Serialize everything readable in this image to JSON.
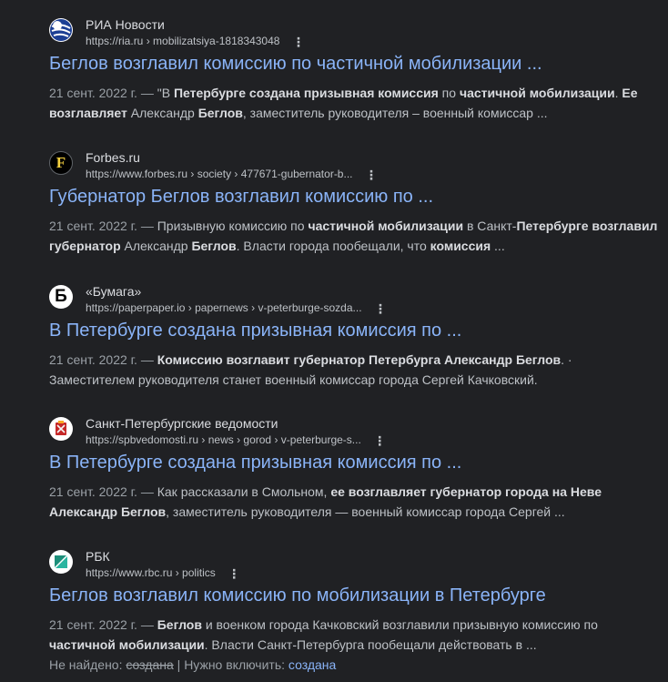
{
  "results": [
    {
      "site_name": "РИА Новости",
      "url_domain": "https://ria.ru",
      "url_path": "› mobilizatsiya-1818343048",
      "title": "Беглов возглавил комиссию по частичной мобилизации ...",
      "date": "21 сент. 2022 г. —",
      "snippet": [
        {
          "t": " \"В ",
          "b": false
        },
        {
          "t": "Петербурге создана призывная комиссия",
          "b": true
        },
        {
          "t": " по ",
          "b": false
        },
        {
          "t": "частичной мобилизации",
          "b": true
        },
        {
          "t": ". ",
          "b": false
        },
        {
          "t": "Ее возглавляет",
          "b": true
        },
        {
          "t": " Александр ",
          "b": false
        },
        {
          "t": "Беглов",
          "b": true
        },
        {
          "t": ", заместитель руководителя – военный комиссар ...",
          "b": false
        }
      ],
      "icon": "ria-globe-icon"
    },
    {
      "site_name": "Forbes.ru",
      "url_domain": "https://www.forbes.ru",
      "url_path": "› society › 477671-gubernator-b...",
      "title": "Губернатор Беглов возглавил комиссию по ...",
      "date": "21 сент. 2022 г. —",
      "snippet": [
        {
          "t": " Призывную комиссию по ",
          "b": false
        },
        {
          "t": "частичной мобилизации",
          "b": true
        },
        {
          "t": " в Санкт-",
          "b": false
        },
        {
          "t": "Петербурге возглавил губернатор",
          "b": true
        },
        {
          "t": " Александр ",
          "b": false
        },
        {
          "t": "Беглов",
          "b": true
        },
        {
          "t": ". Власти города пообещали, что ",
          "b": false
        },
        {
          "t": "комиссия",
          "b": true
        },
        {
          "t": " ...",
          "b": false
        }
      ],
      "icon": "forbes-f-icon",
      "icon_letter": "F"
    },
    {
      "site_name": "«Бумага»",
      "url_domain": "https://paperpaper.io",
      "url_path": "› papernews › v-peterburge-sozda...",
      "title": "В Петербурге создана призывная комиссия по ...",
      "date": "21 сент. 2022 г. —",
      "snippet": [
        {
          "t": " ",
          "b": false
        },
        {
          "t": "Комиссию возглавит губернатор Петербурга Александр Беглов",
          "b": true
        },
        {
          "t": ". · Заместителем руководителя станет военный комиссар города Сергей Качковский.",
          "b": false
        }
      ],
      "icon": "bumaga-b-icon",
      "icon_letter": "Б"
    },
    {
      "site_name": "Санкт-Петербургские ведомости",
      "url_domain": "https://spbvedomosti.ru",
      "url_path": "› news › gorod › v-peterburge-s...",
      "title": "В Петербурге создана призывная комиссия по ...",
      "date": "21 сент. 2022 г. —",
      "snippet": [
        {
          "t": " Как рассказали в Смольном, ",
          "b": false
        },
        {
          "t": "ее возглавляет губернатор города на Неве Александр Беглов",
          "b": true
        },
        {
          "t": ", заместитель руководителя — военный комиссар города Сергей ...",
          "b": false
        }
      ],
      "icon": "spb-coat-of-arms-icon"
    },
    {
      "site_name": "РБК",
      "url_domain": "https://www.rbc.ru",
      "url_path": "› politics",
      "title": "Беглов возглавил комиссию по мобилизации в Петербурге",
      "date": "21 сент. 2022 г. —",
      "snippet": [
        {
          "t": " ",
          "b": false
        },
        {
          "t": "Беглов",
          "b": true
        },
        {
          "t": " и военком города Качковский возглавили призывную комиссию по ",
          "b": false
        },
        {
          "t": "частичной мобилизации",
          "b": true
        },
        {
          "t": ". Власти Санкт-Петербурга пообещали действовать в ...",
          "b": false
        }
      ],
      "icon": "rbc-logo-icon",
      "missing": {
        "not_found_label": "Не найдено:",
        "not_found_term": "создана",
        "divider": "|",
        "must_include_label": "Нужно включить:",
        "must_include_term": "создана"
      }
    }
  ],
  "kebab_glyph": "⋮",
  "colors": {
    "background": "#202124",
    "title_link": "#8ab4f8",
    "text": "#bdc1c6",
    "bold_text": "#dadce0"
  }
}
